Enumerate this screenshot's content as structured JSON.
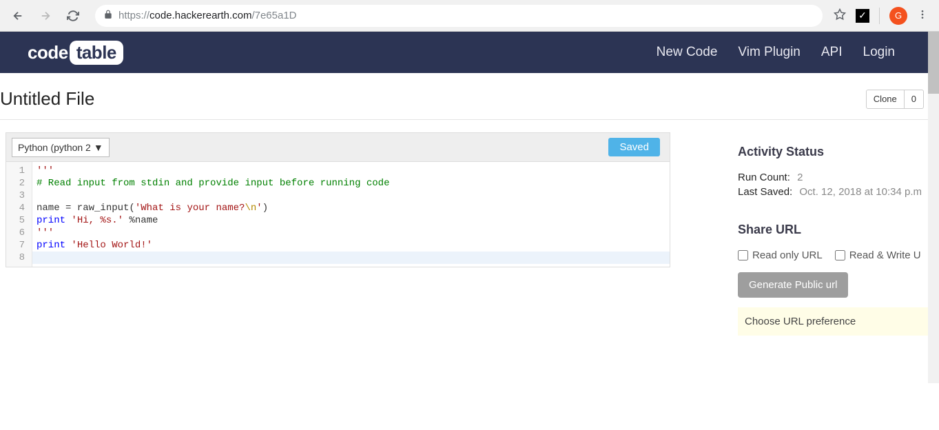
{
  "browser": {
    "url_prefix": "https://",
    "url_host": "code.hackerearth.com",
    "url_path": "/7e65a1D",
    "profile_initial": "G",
    "ext_check": "✓"
  },
  "header": {
    "logo_left": "code",
    "logo_right": "table",
    "links": [
      "New Code",
      "Vim Plugin",
      "API",
      "Login"
    ]
  },
  "page": {
    "title": "Untitled File",
    "clone_label": "Clone",
    "clone_count": "0"
  },
  "editor": {
    "language": "Python (python 2",
    "saved_label": "Saved",
    "code": [
      {
        "t": "str",
        "text": "'''"
      },
      {
        "t": "com",
        "text": "# Read input from stdin and provide input before running code"
      },
      {
        "t": "blank",
        "text": ""
      },
      {
        "t": "mixed",
        "parts": [
          [
            "plain",
            "name = raw_input("
          ],
          [
            "str",
            "'What is your name?"
          ],
          [
            "esc",
            "\\n"
          ],
          [
            "str",
            "'"
          ],
          [
            "plain",
            ")"
          ]
        ]
      },
      {
        "t": "mixed",
        "parts": [
          [
            "kw",
            "print"
          ],
          [
            "plain",
            " "
          ],
          [
            "str",
            "'Hi, %s.'"
          ],
          [
            "plain",
            " %name"
          ]
        ]
      },
      {
        "t": "str",
        "text": "'''"
      },
      {
        "t": "mixed",
        "parts": [
          [
            "kw",
            "print"
          ],
          [
            "plain",
            " "
          ],
          [
            "str",
            "'Hello World!'"
          ]
        ]
      },
      {
        "t": "cursor",
        "text": ""
      }
    ]
  },
  "activity": {
    "heading": "Activity Status",
    "run_count_label": "Run Count:",
    "run_count_value": "2",
    "last_saved_label": "Last Saved:",
    "last_saved_value": "Oct. 12, 2018 at 10:34 p.m"
  },
  "share": {
    "heading": "Share URL",
    "read_only_label": "Read only URL",
    "read_write_label": "Read & Write U",
    "generate_btn": "Generate Public url",
    "choose_msg": "Choose URL preference"
  }
}
